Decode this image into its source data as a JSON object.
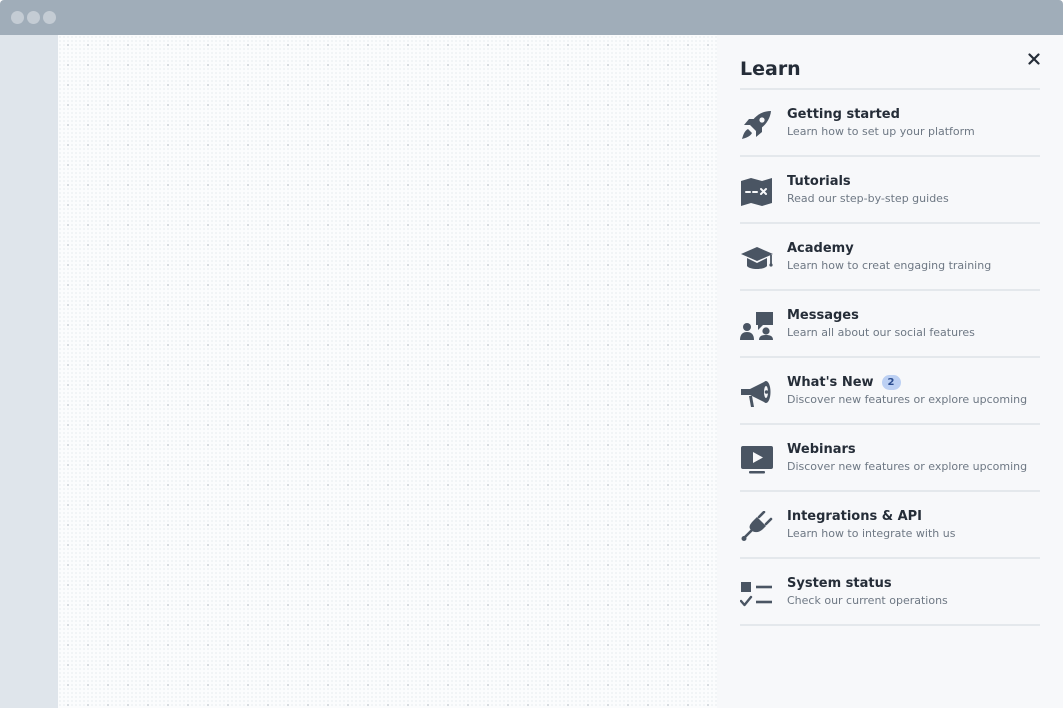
{
  "window": {
    "controls": [
      "window-dot-icon",
      "window-dot-icon",
      "window-dot-icon"
    ]
  },
  "panel": {
    "title": "Learn",
    "close_icon": "close-icon",
    "items": [
      {
        "icon": "rocket-icon",
        "title": "Getting started",
        "description": "Learn how to set up your platform"
      },
      {
        "icon": "map-icon",
        "title": "Tutorials",
        "description": "Read our step-by-step guides"
      },
      {
        "icon": "graduation-cap-icon",
        "title": "Academy",
        "description": "Learn how to creat engaging training"
      },
      {
        "icon": "presenter-icon",
        "title": "Messages",
        "description": "Learn all about our social features"
      },
      {
        "icon": "megaphone-icon",
        "title": "What's New",
        "badge": "2",
        "description": "Discover new features or explore upcoming"
      },
      {
        "icon": "video-play-icon",
        "title": "Webinars",
        "description": "Discover new features or explore upcoming"
      },
      {
        "icon": "plug-icon",
        "title": "Integrations & API",
        "description": "Learn how to integrate with us"
      },
      {
        "icon": "checklist-icon",
        "title": "System status",
        "description": "Check our current operations"
      }
    ]
  },
  "colors": {
    "titlebar": "#a0adb9",
    "panel_background": "#f7f8fa",
    "icon": "#4a5563",
    "badge_background": "#bcd0f3"
  }
}
